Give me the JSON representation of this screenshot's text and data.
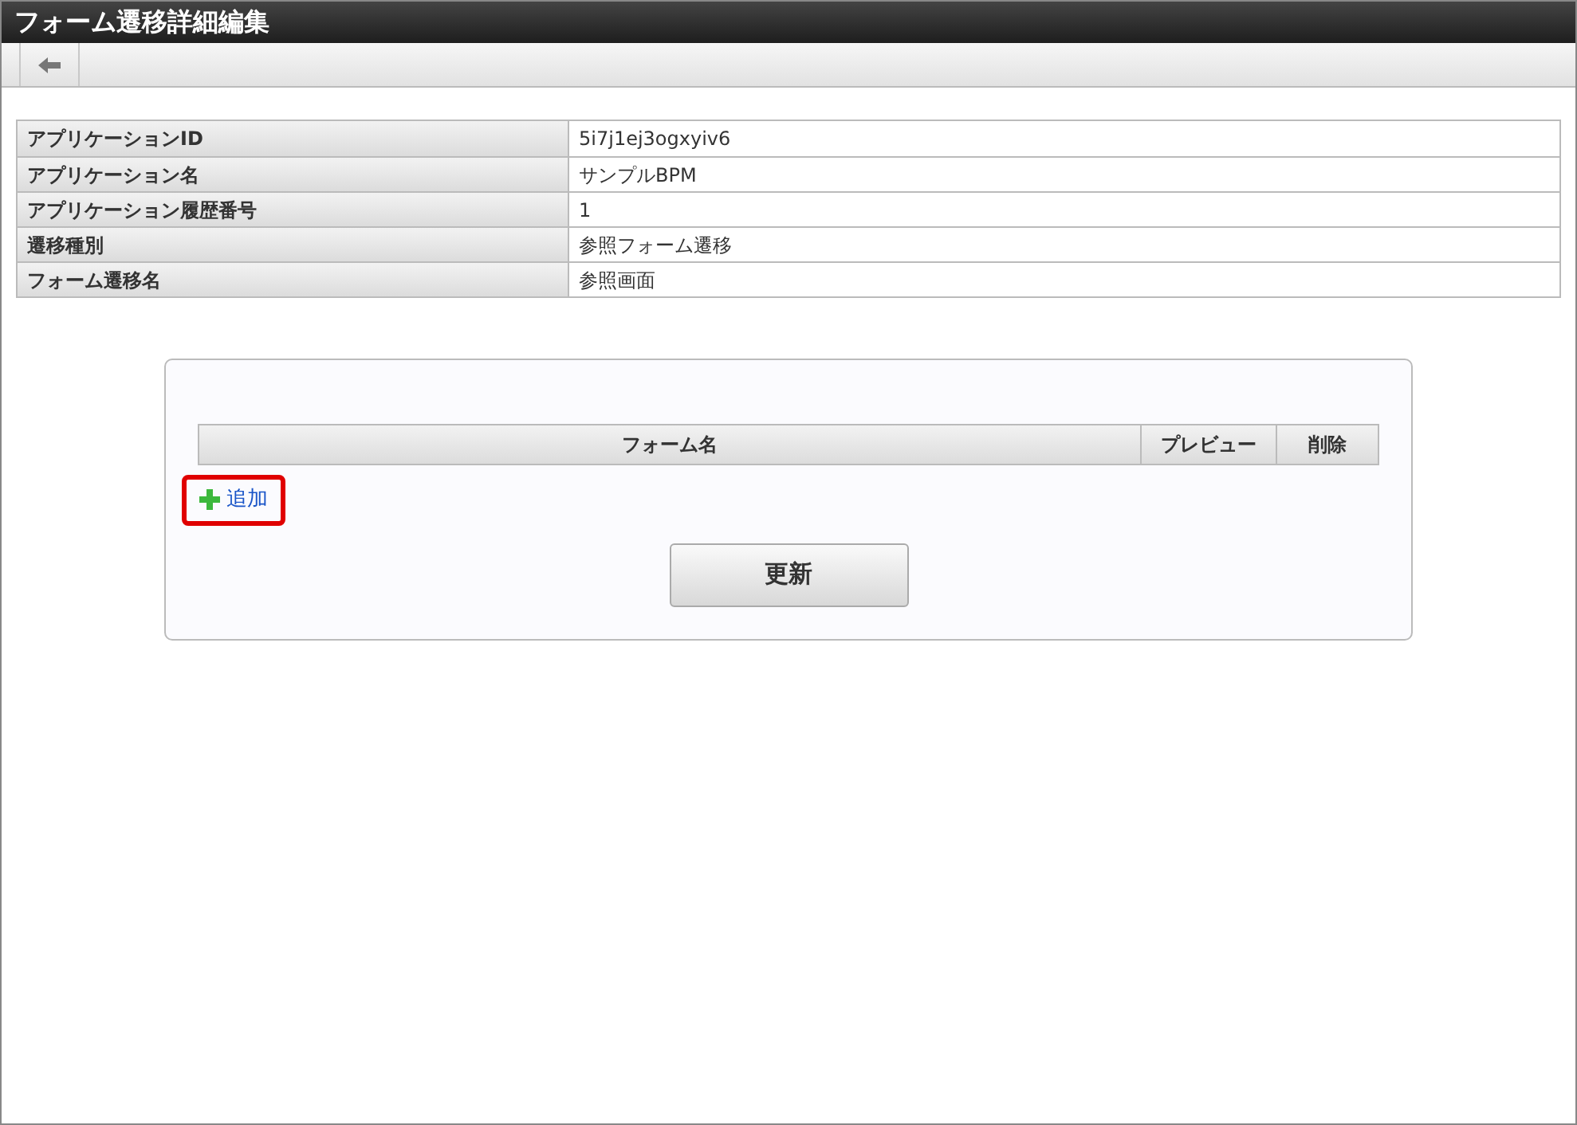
{
  "window": {
    "title": "フォーム遷移詳細編集"
  },
  "details": [
    {
      "label": "アプリケーションID",
      "value": "5i7j1ej3ogxyiv6"
    },
    {
      "label": "アプリケーション名",
      "value": "サンプルBPM"
    },
    {
      "label": "アプリケーション履歴番号",
      "value": "1"
    },
    {
      "label": "遷移種別",
      "value": "参照フォーム遷移"
    },
    {
      "label": "フォーム遷移名",
      "value": "参照画面"
    }
  ],
  "forms_table": {
    "columns": [
      "フォーム名",
      "プレビュー",
      "削除"
    ]
  },
  "add_link": {
    "label": "追加",
    "highlighted": true
  },
  "update_button": "更新"
}
